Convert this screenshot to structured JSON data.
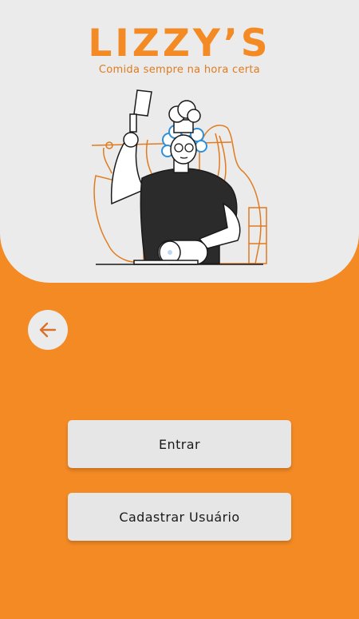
{
  "brand": {
    "name": "LIZZY’S",
    "tagline": "Comida sempre na hora certa"
  },
  "colors": {
    "accent": "#F48A24",
    "panel": "#EBEBEB",
    "button": "#E6E6E6"
  },
  "nav": {
    "back_icon": "arrow-left-icon"
  },
  "actions": {
    "enter_label": "Entrar",
    "register_label": "Cadastrar Usuário"
  }
}
